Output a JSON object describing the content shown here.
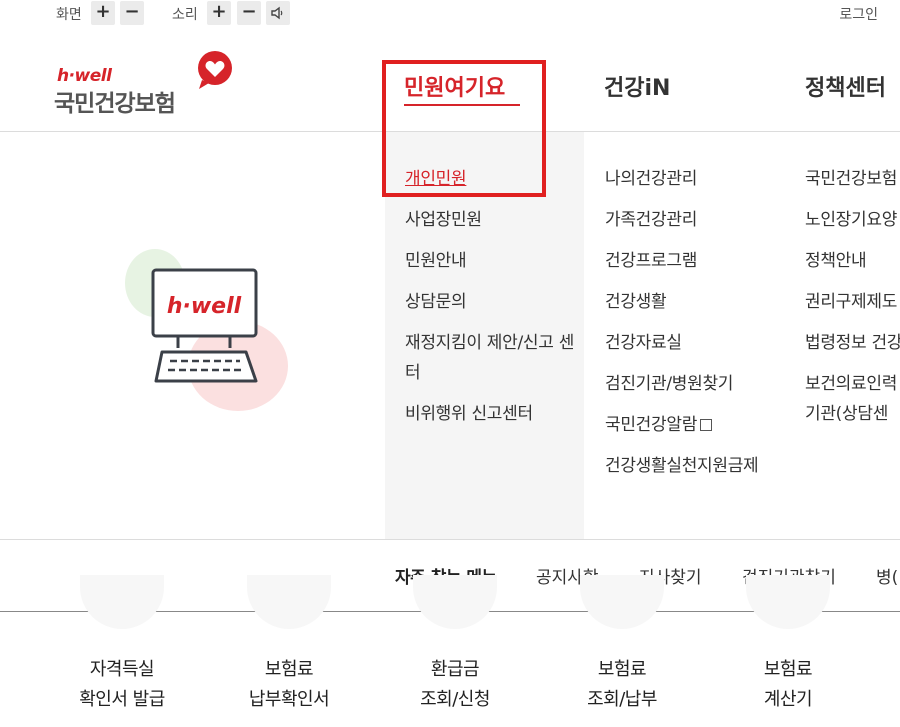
{
  "util": {
    "screen_label": "화면",
    "sound_label": "소리",
    "plus": "+",
    "minus": "−",
    "login": "로그인"
  },
  "logo": {
    "brand": "h·well",
    "name": "국민건강보험"
  },
  "gnb": [
    "민원여기요",
    "건강iN",
    "정책센터"
  ],
  "menu": {
    "col1": [
      "개인민원",
      "사업장민원",
      "민원안내",
      "상담문의",
      "재정지킴이 제안/신고 센터",
      "비위행위 신고센터"
    ],
    "col2": [
      "나의건강관리",
      "가족건강관리",
      "건강프로그램",
      "건강생활",
      "건강자료실",
      "검진기관/병원찾기",
      "국민건강알람",
      "건강생활실천지원금제"
    ],
    "col3": [
      "국민건강보험",
      "노인장기요양",
      "정책안내",
      "권리구제제도",
      "법령정보 건강",
      "보건의료인력 문기관(상담센"
    ]
  },
  "illustration_text": "h·well",
  "favorites": {
    "title": "자주 찾는 메뉴",
    "links": [
      "공지사항",
      "지사찾기",
      "검진기관찾기",
      "병("
    ]
  },
  "quick": [
    {
      "l1": "자격득실",
      "l2": "확인서 발급"
    },
    {
      "l1": "보험료",
      "l2": "납부확인서"
    },
    {
      "l1": "환급금",
      "l2": "조회/신청"
    },
    {
      "l1": "보험료",
      "l2": "조회/납부"
    },
    {
      "l1": "보험료",
      "l2": "계산기"
    }
  ],
  "colors": {
    "accent": "#d6242a",
    "highlight": "#e02020",
    "menu_bg": "#f5f5f5"
  }
}
